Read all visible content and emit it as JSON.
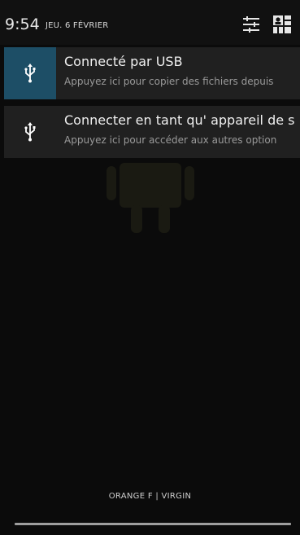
{
  "status": {
    "time": "9:54",
    "date": "JEU. 6 FÉVRIER"
  },
  "header_icons": {
    "settings": "settings-sliders-icon",
    "quick_settings": "quick-settings-icon"
  },
  "notifications": [
    {
      "icon": "usb-icon",
      "title": "Connecté par USB",
      "text": "Appuyez ici pour copier des fichiers depuis"
    },
    {
      "icon": "usb-icon",
      "title": "Connecter en tant qu' appareil de s",
      "text": "Appuyez ici pour accéder aux autres option"
    }
  ],
  "carrier": "ORANGE F | VIRGIN",
  "colors": {
    "accent": "#1d4e66",
    "background": "#0b0b0b"
  }
}
